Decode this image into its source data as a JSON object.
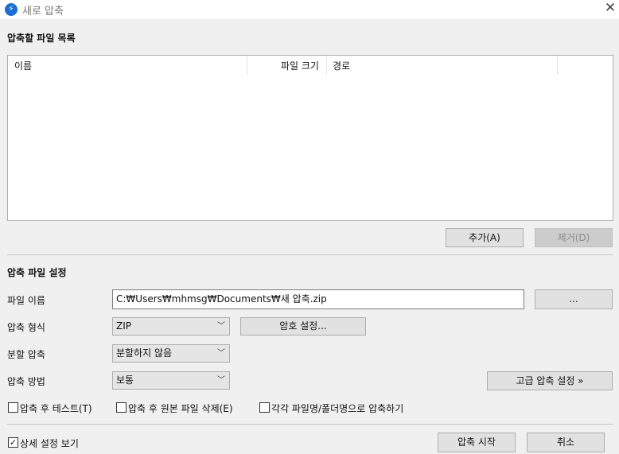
{
  "window": {
    "title": "새로 압축",
    "close_glyph": "✕"
  },
  "file_list": {
    "section_title": "압축할 파일 목록",
    "columns": {
      "name": "이름",
      "size": "파일 크기",
      "path": "경로"
    }
  },
  "list_actions": {
    "add": "추가(A)",
    "remove": "제거(D)"
  },
  "settings": {
    "section_title": "압축 파일 설정",
    "filename": {
      "label": "파일 이름",
      "value": "C:₩Users₩mhmsg₩Documents₩새 압축.zip",
      "browse": "..."
    },
    "format": {
      "label": "압축 형식",
      "value": "ZIP"
    },
    "password_button": "암호 설정...",
    "split": {
      "label": "분할 압축",
      "value": "분할하지 않음"
    },
    "method": {
      "label": "압축 방법",
      "value": "보통"
    },
    "advanced_button": "고급 압축 설정 »"
  },
  "options": {
    "test_after": {
      "label": "압축 후 테스트(T)",
      "checked": false
    },
    "delete_original": {
      "label": "압축 후 원본 파일 삭제(E)",
      "checked": false
    },
    "each_file": {
      "label": "각각 파일명/폴더명으로 압축하기",
      "checked": false
    }
  },
  "footer": {
    "show_details": {
      "label": "상세 설정 보기",
      "checked": true,
      "glyph": "✓"
    },
    "start": "압축 시작",
    "cancel": "취소"
  }
}
